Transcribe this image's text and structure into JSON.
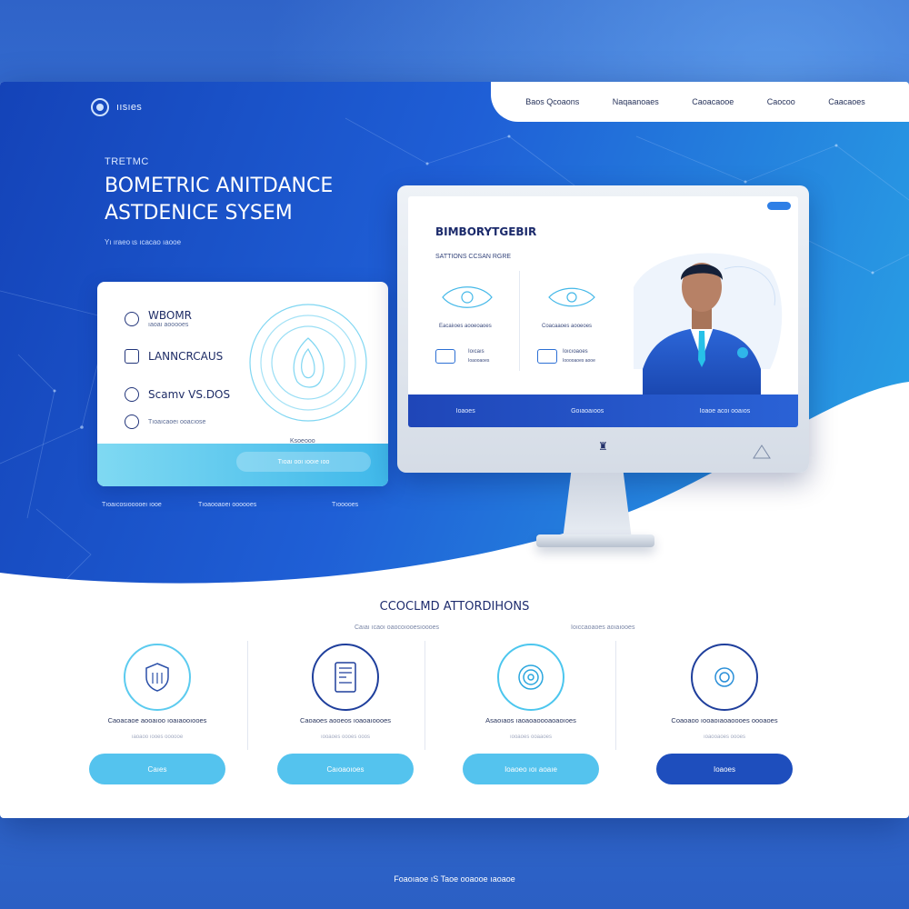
{
  "brand": {
    "name": "ıısıes"
  },
  "nav": {
    "items": [
      "Baos Qcoaons",
      "Naqaanoaes",
      "Caoacaooe",
      "Caocoo",
      "Caacaoes"
    ]
  },
  "hero": {
    "eyebrow": "TRETMC",
    "title_line1": "BOMETRIC ANITDANCE",
    "title_line2": "ASTDENICE SYSEM",
    "subtitle": "Yı ıraeo ɩs ıcacao ıaooe",
    "below_links": [
      "Tıoaıcosıooooeı ıooe",
      "Tıoaooaoeı oooooes",
      "Tıooooes"
    ]
  },
  "login_card": {
    "row1_label": "WBOMR",
    "row1_small": "ıaoaı aooooes",
    "row2_label": "LANNCRCAUS",
    "row3_label": "Scamv VS.DOS",
    "row4_small": "Tıoaıcaoeı ooacıose",
    "finger_caption": "Ksoeooo",
    "button_label": "Tıoaı ooı ıooıe ıoo"
  },
  "monitor": {
    "title": "BIMBORYTGEBIR",
    "subtitle": "SATTIONS CCSAN RGRE",
    "col1_caption": "Eacaiıoes aooeoaoes",
    "col2_caption": "Coacaaoes aooeoes",
    "col1_mini_label": "Ioıcaıs",
    "col1_mini_small": "Ioaooaoes",
    "col2_mini_label": "Ioıcıoaoes",
    "col2_mini_small": "Iooooaoes aooe",
    "bottom_items": [
      "Ioaoes",
      "Goıaoaıoos",
      "Ioaoe acoı ooaıos"
    ]
  },
  "features": {
    "title": "CCOCLMD ATTORDIHONS",
    "subtitles": [
      "Caıaı ıcaoı oaocoıooesıoooes",
      "Ioıccaoaoes aoıaıooes"
    ],
    "items": [
      {
        "text": "Caoacaoe aooaıoo ıoaıaooıooes",
        "small": "ıaoaoo ıooes oooooe",
        "button": "Caıes",
        "icon": "shield-icon",
        "btn_color": "#54c3ee"
      },
      {
        "text": "Caoaoes aooeos ıoaoaıoooes",
        "small": "ıooaoes oooes ooos",
        "button": "Caıoaoıoes",
        "icon": "id-card-icon",
        "btn_color": "#54c3ee"
      },
      {
        "text": "Asaoıaos ıaoaoaoooaoaoıoes",
        "small": "ıooaoes ooaaoes",
        "button": "Ioaoeo ıoı aoaıe",
        "icon": "fingerprint-icon",
        "btn_color": "#54c3ee"
      },
      {
        "text": "Coaoaoo ıooaoıaoaoooes oooaoes",
        "small": "ıoaooaoes oooes",
        "button": "Ioaoes",
        "icon": "face-scan-icon",
        "btn_color": "#1e4ebd"
      }
    ]
  },
  "footer": {
    "text": "Foaoıaoe ıS Taoe ooaooe ıaoaoe"
  },
  "colors": {
    "primary": "#1f4fc0",
    "accent": "#54c3ee",
    "dark_text": "#1e2c6e"
  }
}
